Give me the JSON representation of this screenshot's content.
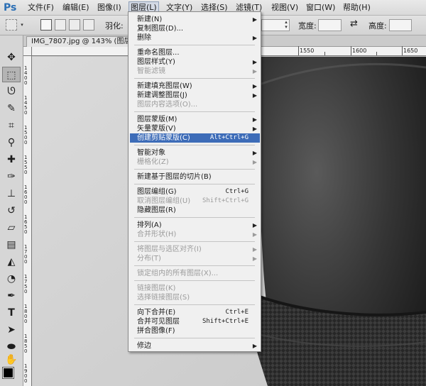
{
  "app": {
    "logo": "Ps"
  },
  "menubar": {
    "items": [
      {
        "label": "文件(F)"
      },
      {
        "label": "编辑(E)"
      },
      {
        "label": "图像(I)"
      },
      {
        "label": "图层(L)"
      },
      {
        "label": "文字(Y)"
      },
      {
        "label": "选择(S)"
      },
      {
        "label": "滤镜(T)"
      },
      {
        "label": "视图(V)"
      },
      {
        "label": "窗口(W)"
      },
      {
        "label": "帮助(H)"
      }
    ]
  },
  "options": {
    "feather_label": "羽化:",
    "width_label": "宽度:",
    "height_label": "高度:"
  },
  "document": {
    "tab_title": "IMG_7807.jpg @ 143% (图层"
  },
  "rulers": {
    "top": [
      "1550",
      "1600",
      "1650"
    ],
    "left": [
      "1400",
      "1450",
      "1500",
      "1550",
      "1600",
      "1650",
      "1700",
      "1750",
      "1800",
      "1850",
      "1900"
    ]
  },
  "layer_menu": {
    "items": [
      {
        "label": "新建(N)",
        "submenu": true
      },
      {
        "label": "复制图层(D)..."
      },
      {
        "label": "删除",
        "submenu": true
      },
      {
        "label": "重命名图层..."
      },
      {
        "label": "图层样式(Y)",
        "submenu": true
      },
      {
        "label": "智能滤镜",
        "submenu": true,
        "disabled": true
      },
      {
        "label": "新建填充图层(W)",
        "submenu": true
      },
      {
        "label": "新建调整图层(J)",
        "submenu": true
      },
      {
        "label": "图层内容选项(O)...",
        "disabled": true
      },
      {
        "label": "图层蒙版(M)",
        "submenu": true
      },
      {
        "label": "矢量蒙版(V)",
        "submenu": true
      },
      {
        "label": "创建剪贴蒙版(C)",
        "shortcut": "Alt+Ctrl+G",
        "highlighted": true
      },
      {
        "label": "智能对象",
        "submenu": true
      },
      {
        "label": "栅格化(Z)",
        "submenu": true,
        "disabled": true
      },
      {
        "label": "新建基于图层的切片(B)"
      },
      {
        "label": "图层编组(G)",
        "shortcut": "Ctrl+G"
      },
      {
        "label": "取消图层编组(U)",
        "shortcut": "Shift+Ctrl+G",
        "disabled": true
      },
      {
        "label": "隐藏图层(R)"
      },
      {
        "label": "排列(A)",
        "submenu": true
      },
      {
        "label": "合并形状(H)",
        "submenu": true,
        "disabled": true
      },
      {
        "label": "将图层与选区对齐(I)",
        "submenu": true,
        "disabled": true
      },
      {
        "label": "分布(T)",
        "submenu": true,
        "disabled": true
      },
      {
        "label": "锁定组内的所有图层(X)...",
        "disabled": true
      },
      {
        "label": "链接图层(K)",
        "disabled": true
      },
      {
        "label": "选择链接图层(S)",
        "disabled": true
      },
      {
        "label": "向下合并(E)",
        "shortcut": "Ctrl+E"
      },
      {
        "label": "合并可见图层",
        "shortcut": "Shift+Ctrl+E"
      },
      {
        "label": "拼合图像(F)"
      },
      {
        "label": "修边",
        "submenu": true
      }
    ]
  },
  "colors": {
    "highlight": "#3d6cb8",
    "foreground": "#000000"
  }
}
